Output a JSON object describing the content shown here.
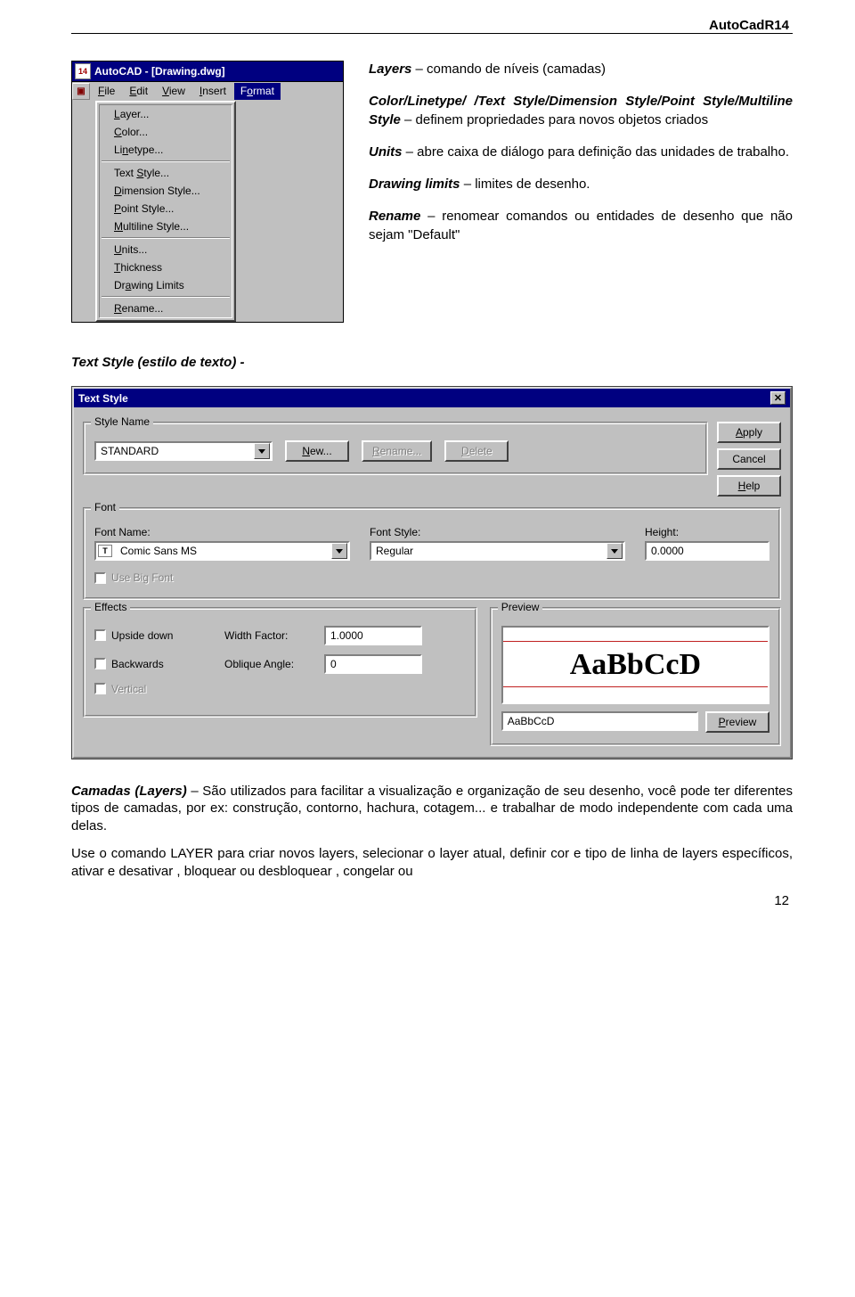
{
  "header": "AutoCadR14",
  "page_number": "12",
  "menu": {
    "title": "AutoCAD - [Drawing.dwg]",
    "bar": {
      "file": "File",
      "edit": "Edit",
      "view": "View",
      "insert": "Insert",
      "format": "Format"
    },
    "items": {
      "layer": "Layer...",
      "color": "Color...",
      "linetype": "Linetype...",
      "text_style": "Text Style...",
      "dimension_style": "Dimension Style...",
      "point_style": "Point Style...",
      "multiline_style": "Multiline Style...",
      "units": "Units...",
      "thickness": "Thickness",
      "drawing_limits": "Drawing Limits",
      "rename": "Rename..."
    }
  },
  "desc": {
    "layers_lead": "Layers",
    "layers_rest": " – comando de níveis (camadas)",
    "styles_lead": "Color/Linetype/ /Text Style/Dimension Style/Point Style/Multiline Style",
    "styles_rest": " – definem propriedades para novos objetos criados",
    "units_lead": "Units",
    "units_rest": " – abre caixa de diálogo para definição das unidades de trabalho.",
    "limits_lead": "Drawing limits",
    "limits_rest": " – limites de desenho.",
    "rename_lead": "Rename",
    "rename_rest": " – renomear comandos ou entidades de  desenho que não sejam \"Default\""
  },
  "section_heading": "Text Style (estilo de texto) -",
  "dialog": {
    "title": "Text Style",
    "group_style_name": "Style Name",
    "combo_style_value": "STANDARD",
    "btn_new": "New...",
    "btn_rename": "Rename...",
    "btn_delete": "Delete",
    "btn_apply": "Apply",
    "btn_cancel": "Cancel",
    "btn_help": "Help",
    "group_font": "Font",
    "lbl_font_name": "Font Name:",
    "combo_font_value": "Comic Sans MS",
    "lbl_font_style": "Font Style:",
    "combo_fontstyle_value": "Regular",
    "lbl_height": "Height:",
    "txt_height": "0.0000",
    "chk_big_font": "Use Big Font",
    "group_effects": "Effects",
    "chk_upside": "Upside down",
    "chk_backwards": "Backwards",
    "chk_vertical": "Vertical",
    "lbl_width": "Width Factor:",
    "txt_width": "1.0000",
    "lbl_oblique": "Oblique Angle:",
    "txt_oblique": "0",
    "group_preview": "Preview",
    "preview_big": "AaBbCcD",
    "preview_input": "AaBbCcD",
    "btn_preview": "Preview"
  },
  "body": {
    "p1_lead": "Camadas (Layers)",
    "p1_rest": " – São utilizados para facilitar a visualização e organização de seu desenho, você pode ter diferentes tipos de camadas, por ex: construção, contorno, hachura, cotagem... e trabalhar de modo independente com cada uma delas.",
    "p2": "Use  o comando LAYER para criar novos layers, selecionar o layer atual, definir cor e tipo de linha de layers específicos, ativar e desativar , bloquear ou desbloquear , congelar ou"
  }
}
